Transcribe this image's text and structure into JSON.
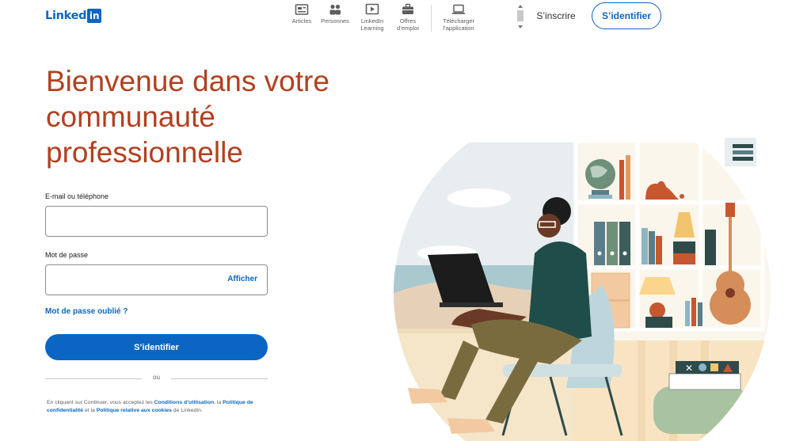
{
  "header": {
    "logo_text": "Linked",
    "logo_box": "in",
    "nav": [
      {
        "label": "Articles",
        "icon": "articles-icon"
      },
      {
        "label": "Personnes",
        "icon": "people-icon"
      },
      {
        "label": "LinkedIn\nLearning",
        "icon": "learning-icon"
      },
      {
        "label": "Offres\nd’emploi",
        "icon": "jobs-icon"
      },
      {
        "label": "Télécharger\nl’application",
        "icon": "laptop-icon"
      }
    ],
    "join_label": "S’inscrire",
    "signin_label": "S’identifier"
  },
  "hero": {
    "title_line1": "Bienvenue dans votre",
    "title_line2": "communauté",
    "title_line3": "professionnelle"
  },
  "form": {
    "email_label": "E-mail ou téléphone",
    "email_value": "",
    "password_label": "Mot de passe",
    "password_value": "",
    "show_label": "Afficher",
    "forgot_label": "Mot de passe oublié ?",
    "submit_label": "S’identifier",
    "or_label": "ou"
  },
  "legal": {
    "prefix": "En cliquant sur Continuer, vous acceptez les ",
    "terms": "Conditions d’utilisation",
    "sep1": ", la ",
    "privacy": "Politique de confidentialité",
    "sep2": " et la ",
    "cookies": "Politique relative aux cookies",
    "suffix": " de LinkedIn."
  },
  "colors": {
    "brand": "#0a66c2",
    "title": "#b24020"
  }
}
